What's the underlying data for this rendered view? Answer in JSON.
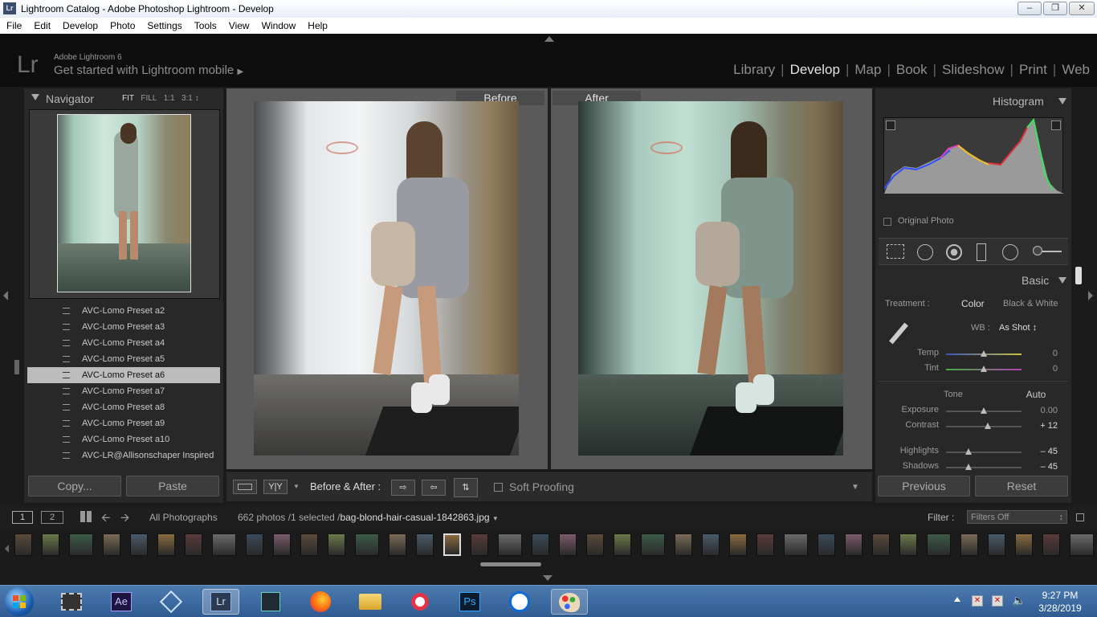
{
  "window": {
    "title": "Lightroom Catalog - Adobe Photoshop Lightroom - Develop",
    "app_badge": "Lr"
  },
  "menu": [
    "File",
    "Edit",
    "Develop",
    "Photo",
    "Settings",
    "Tools",
    "View",
    "Window",
    "Help"
  ],
  "identity": {
    "logo": "Lr",
    "version": "Adobe Lightroom 6",
    "mobile_prompt": "Get started with Lightroom mobile"
  },
  "modules": [
    "Library",
    "Develop",
    "Map",
    "Book",
    "Slideshow",
    "Print",
    "Web"
  ],
  "active_module": "Develop",
  "navigator": {
    "title": "Navigator",
    "zoom_options": [
      "FIT",
      "FILL",
      "1:1",
      "3:1"
    ]
  },
  "presets": [
    "AVC-Lomo Preset a2",
    "AVC-Lomo Preset a3",
    "AVC-Lomo Preset a4",
    "AVC-Lomo Preset a5",
    "AVC-Lomo Preset a6",
    "AVC-Lomo Preset a7",
    "AVC-Lomo Preset a8",
    "AVC-Lomo Preset a9",
    "AVC-Lomo Preset a10",
    "AVC-LR@Allisonschaper Inspired"
  ],
  "selected_preset": "AVC-Lomo Preset a6",
  "left_buttons": {
    "copy": "Copy...",
    "paste": "Paste"
  },
  "view": {
    "before": "Before",
    "after": "After"
  },
  "toolbar": {
    "mode_label": "Before & After :",
    "yy": "Y|Y",
    "soft_proofing": "Soft Proofing"
  },
  "histogram": {
    "title": "Histogram",
    "original_photo": "Original Photo"
  },
  "basic": {
    "title": "Basic",
    "treatment_label": "Treatment :",
    "treatment_color": "Color",
    "treatment_bw": "Black & White",
    "wb_label": "WB :",
    "wb_value": "As Shot",
    "tone_label": "Tone",
    "auto": "Auto",
    "sliders": [
      {
        "label": "Temp",
        "value": "0",
        "pos": 0.5
      },
      {
        "label": "Tint",
        "value": "0",
        "pos": 0.5
      },
      {
        "label": "Exposure",
        "value": "0.00",
        "pos": 0.5
      },
      {
        "label": "Contrast",
        "value": "+ 12",
        "pos": 0.56
      },
      {
        "label": "Highlights",
        "value": "– 45",
        "pos": 0.28
      },
      {
        "label": "Shadows",
        "value": "– 45",
        "pos": 0.28
      }
    ]
  },
  "right_buttons": {
    "previous": "Previous",
    "reset": "Reset"
  },
  "filmstrip_bar": {
    "view1": "1",
    "view2": "2",
    "source": "All Photographs",
    "count": "662 photos /1 selected /",
    "filename": "bag-blond-hair-casual-1842863.jpg",
    "filter_label": "Filter :",
    "filter_value": "Filters Off"
  },
  "clock": {
    "time": "9:27 PM",
    "date": "3/28/2019"
  },
  "taskbar_apps": [
    "start-orb",
    "movie-maker",
    "after-effects",
    "app-diamond",
    "lightroom",
    "filmora",
    "firefox",
    "file-explorer",
    "camera-app",
    "photoshop",
    "teamviewer",
    "paint"
  ]
}
